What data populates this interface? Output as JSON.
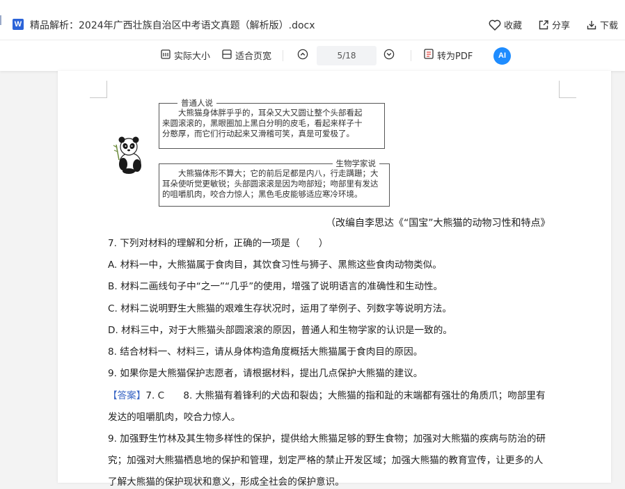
{
  "header": {
    "file_icon_letter": "W",
    "title": "精品解析：2024年广西壮族自治区中考语文真题（解析版）.docx",
    "actions": {
      "favorite": "收藏",
      "share": "分享",
      "download": "下载"
    }
  },
  "toolbar": {
    "actual_size": "实际大小",
    "fit_page": "适合页宽",
    "page_indicator": "5/18",
    "to_pdf": "转为PDF",
    "ai_label": "AI"
  },
  "document": {
    "bubble1": {
      "label": "普通人说",
      "lines": [
        "大熊猫身体胖乎乎的，耳朵又大又圆让整个头部看起",
        "来圆滚滚的，黑眼圈加上黑白分明的皮毛，看起来样子十",
        "分憨厚，而它们行动起来又滑稽可笑，真是可爱极了。"
      ]
    },
    "bubble2": {
      "label": "生物学家说",
      "lines": [
        "大熊猫体形不算大；它的前后足都是内八，行走蹒跚；大",
        "耳朵使听觉更敏锐；头部圆滚滚是因为吻部短；吻部里有发达",
        "的咀嚼肌肉，咬合力惊人；黑色毛皮能够适应寒冷环境。"
      ]
    },
    "source": "（改编自李思达《“国宝”大熊猫的动物习性和特点》",
    "q7": "7. 下列对材料的理解和分析，正确的一项是（　　）",
    "optA": "A. 材料一中，大熊猫属于食肉目，其饮食习性与狮子、黑熊这些食肉动物类似。",
    "optB": "B. 材料二画线句子中“之一”“几乎”的使用，增强了说明语言的准确性和生动性。",
    "optC": "C. 材料二说明野生大熊猫的艰难生存状况时，运用了举例子、列数字等说明方法。",
    "optD": "D. 材料三中，对于大熊猫头部圆滚滚的原因，普通人和生物学家的认识是一致的。",
    "q8": "8. 结合材料一、材料三，请从身体构造角度概括大熊猫属于食肉目的原因。",
    "q9": "9. 如果你是大熊猫保护志愿者，请根据材料，提出几点保护大熊猫的建议。",
    "answer_tag": "【答案】",
    "answer_line1": "7. C　　8. 大熊猫有着锋利的犬齿和裂齿；大熊猫的指和趾的末端都有强壮的角质爪；吻部里有",
    "answer_line2": "发达的咀嚼肌肉，咬合力惊人。",
    "answer_line3": "9. 加强野生竹林及其生物多样性的保护，提供给大熊猫足够的野生食物；加强对大熊猫的疾病与防治的研",
    "answer_line4": "究；加强对大熊猫栖息地的保护和管理，划定严格的禁止开发区域；加强大熊猫的教育宣传，让更多的人",
    "answer_line5": "了解大熊猫的保护现状和意义，形成全社会的保护意识。"
  },
  "colors": {
    "accent_blue": "#1e8cff",
    "answer_tag": "#3a66c4"
  }
}
